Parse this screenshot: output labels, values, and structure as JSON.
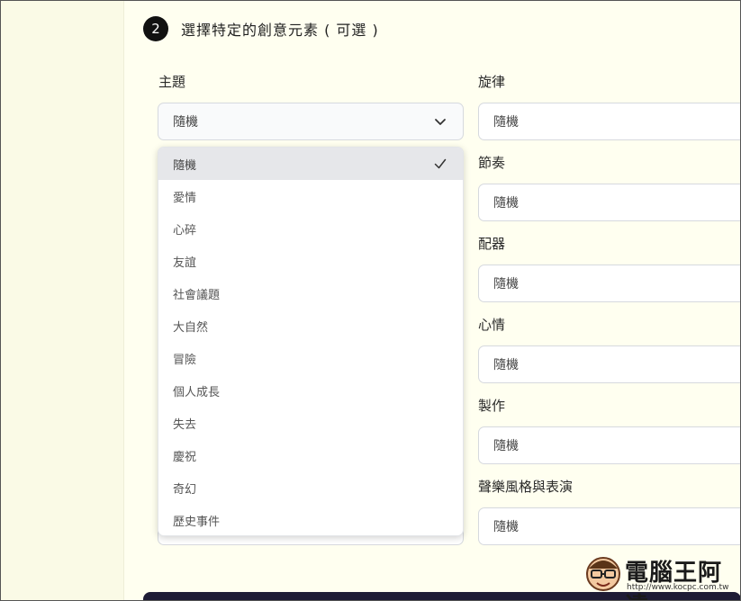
{
  "step": {
    "number": "2",
    "title": "選擇特定的創意元素 ( 可選 )"
  },
  "theme": {
    "label": "主題",
    "value": "隨機",
    "options": [
      {
        "label": "隨機",
        "selected": true
      },
      {
        "label": "愛情",
        "selected": false
      },
      {
        "label": "心碎",
        "selected": false
      },
      {
        "label": "友誼",
        "selected": false
      },
      {
        "label": "社會議題",
        "selected": false
      },
      {
        "label": "大自然",
        "selected": false
      },
      {
        "label": "冒險",
        "selected": false
      },
      {
        "label": "個人成長",
        "selected": false
      },
      {
        "label": "失去",
        "selected": false
      },
      {
        "label": "慶祝",
        "selected": false
      },
      {
        "label": "奇幻",
        "selected": false
      },
      {
        "label": "歷史事件",
        "selected": false
      }
    ]
  },
  "right_fields": [
    {
      "label": "旋律",
      "value": "隨機"
    },
    {
      "label": "節奏",
      "value": "隨機"
    },
    {
      "label": "配器",
      "value": "隨機"
    },
    {
      "label": "心情",
      "value": "隨機"
    },
    {
      "label": "製作",
      "value": "隨機"
    },
    {
      "label": "聲樂風格與表演",
      "value": "隨機"
    }
  ],
  "watermark": {
    "name": "電腦王阿達",
    "url": "http://www.kocpc.com.tw"
  },
  "colors": {
    "background": "#fdfde8",
    "panel": "#fffff0",
    "selected_option": "#e6e7ea",
    "bottom_bar": "#1e1c35"
  }
}
